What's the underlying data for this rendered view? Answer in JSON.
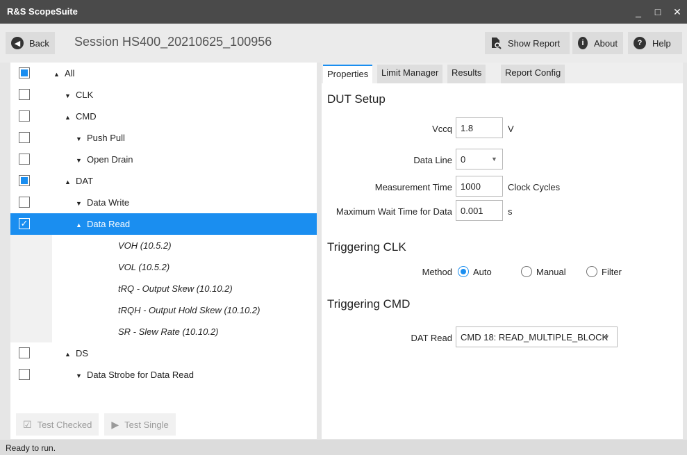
{
  "window": {
    "title": "R&S ScopeSuite",
    "minimize": "_",
    "maximize": "□",
    "close": "✕"
  },
  "toolbar": {
    "back_label": "Back",
    "session_title": "Session  HS400_20210625_100956",
    "show_report_label": "Show Report",
    "about_label": "About",
    "help_label": "Help"
  },
  "tree": {
    "items": [
      {
        "label": "All",
        "arrow": "▲",
        "check": "partial",
        "level": 0
      },
      {
        "label": "CLK",
        "arrow": "▼",
        "check": "unchecked",
        "level": 1
      },
      {
        "label": "CMD",
        "arrow": "▲",
        "check": "unchecked",
        "level": 1
      },
      {
        "label": "Push Pull",
        "arrow": "▼",
        "check": "unchecked",
        "level": 2
      },
      {
        "label": "Open Drain",
        "arrow": "▼",
        "check": "unchecked",
        "level": 2
      },
      {
        "label": "DAT",
        "arrow": "▲",
        "check": "partial",
        "level": 1
      },
      {
        "label": "Data Write",
        "arrow": "▼",
        "check": "unchecked",
        "level": 2
      },
      {
        "label": "Data Read",
        "arrow": "▲",
        "check": "checked",
        "level": 2,
        "selected": true
      },
      {
        "label": "VOH (10.5.2)",
        "arrow": "",
        "check": "none",
        "level": 3
      },
      {
        "label": "VOL (10.5.2)",
        "arrow": "",
        "check": "none",
        "level": 3
      },
      {
        "label": "tRQ - Output Skew (10.10.2)",
        "arrow": "",
        "check": "none",
        "level": 3
      },
      {
        "label": "tRQH - Output Hold Skew (10.10.2)",
        "arrow": "",
        "check": "none",
        "level": 3
      },
      {
        "label": "SR - Slew Rate (10.10.2)",
        "arrow": "",
        "check": "none",
        "level": 3
      },
      {
        "label": "DS",
        "arrow": "▲",
        "check": "unchecked",
        "level": 1
      },
      {
        "label": "Data Strobe for Data Read",
        "arrow": "▼",
        "check": "unchecked",
        "level": 2
      }
    ]
  },
  "actions": {
    "test_checked": "Test Checked",
    "test_single": "Test Single"
  },
  "tabs": [
    "Properties",
    "Limit Manager",
    "Results",
    "Report Config"
  ],
  "dut_setup": {
    "title": "DUT Setup",
    "vccq_label": "Vccq",
    "vccq_value": "1.8",
    "vccq_unit": "V",
    "data_line_label": "Data Line",
    "data_line_value": "0",
    "meas_time_label": "Measurement Time",
    "meas_time_value": "1000",
    "meas_time_unit": "Clock Cycles",
    "max_wait_label": "Maximum Wait Time for Data",
    "max_wait_value": "0.001",
    "max_wait_unit": "s"
  },
  "trig_clk": {
    "title": "Triggering CLK",
    "method_label": "Method",
    "opt_auto": "Auto",
    "opt_manual": "Manual",
    "opt_filter": "Filter"
  },
  "trig_cmd": {
    "title": "Triggering CMD",
    "dat_read_label": "DAT Read",
    "dat_read_value": "CMD 18: READ_MULTIPLE_BLOCK"
  },
  "status": {
    "text": "Ready to run."
  },
  "colors": {
    "accent": "#1a8ef0",
    "titlebar": "#4a4a4a"
  }
}
